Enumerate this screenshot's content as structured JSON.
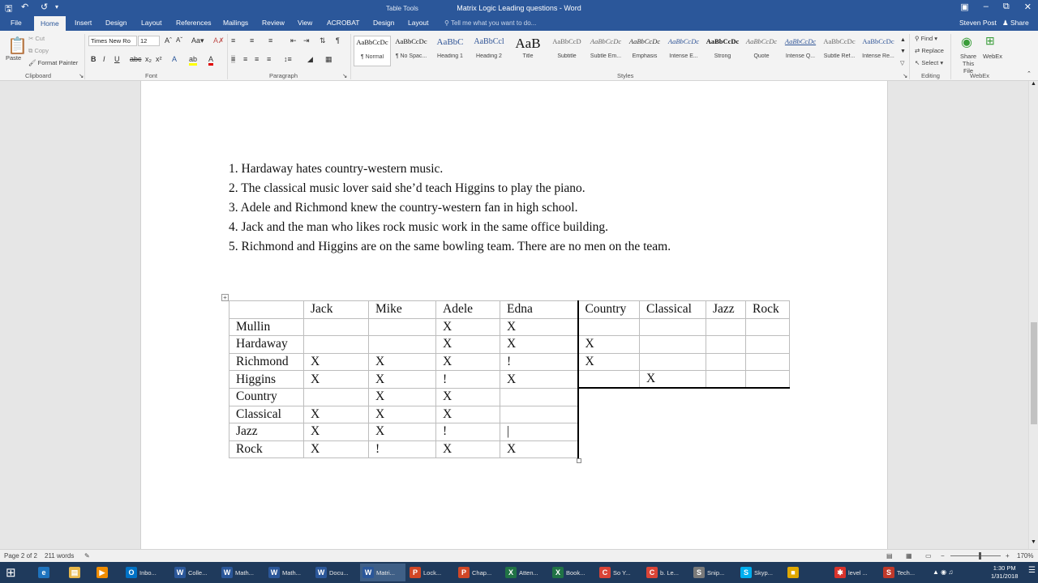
{
  "titlebar": {
    "context_label": "Table Tools",
    "doc_title": "Matrix Logic  Leading questions - Word",
    "user": "Steven Post",
    "share": "Share"
  },
  "tabs": [
    "File",
    "Home",
    "Insert",
    "Design",
    "Layout",
    "References",
    "Mailings",
    "Review",
    "View",
    "ACROBAT"
  ],
  "context_tabs": [
    "Design",
    "Layout"
  ],
  "tell_me_placeholder": "Tell me what you want to do...",
  "ribbon": {
    "clipboard": {
      "paste": "Paste",
      "cut": "Cut",
      "copy": "Copy",
      "format_painter": "Format Painter",
      "label": "Clipboard"
    },
    "font": {
      "name": "Times New Ro",
      "size": "12",
      "label": "Font"
    },
    "paragraph_label": "Paragraph",
    "styles_label": "Styles",
    "styles": [
      {
        "sample": "AaBbCcDc",
        "name": "¶ Normal"
      },
      {
        "sample": "AaBbCcDc",
        "name": "¶ No Spac..."
      },
      {
        "sample": "AaBbC",
        "name": "Heading 1"
      },
      {
        "sample": "AaBbCcl",
        "name": "Heading 2"
      },
      {
        "sample": "AaB",
        "name": "Title"
      },
      {
        "sample": "AaBbCcD",
        "name": "Subtitle"
      },
      {
        "sample": "AaBbCcDc",
        "name": "Subtle Em..."
      },
      {
        "sample": "AaBbCcDc",
        "name": "Emphasis"
      },
      {
        "sample": "AaBbCcDc",
        "name": "Intense E..."
      },
      {
        "sample": "AaBbCcDc",
        "name": "Strong"
      },
      {
        "sample": "AaBbCcDc",
        "name": "Quote"
      },
      {
        "sample": "AaBbCcDc",
        "name": "Intense Q..."
      },
      {
        "sample": "AaBbCcDc",
        "name": "Subtle Ref..."
      },
      {
        "sample": "AaBbCcDc",
        "name": "Intense Re..."
      }
    ],
    "editing": {
      "find": "Find",
      "replace": "Replace",
      "select": "Select",
      "label": "Editing"
    },
    "webex": {
      "share": "Share This File",
      "webex": "WebEx",
      "label": "WebEx"
    }
  },
  "clues": [
    "1. Hardaway hates country-western music.",
    "2. The classical music lover said she’d teach Higgins to play the piano.",
    "3. Adele and Richmond knew the country-western fan in high school.",
    "4. Jack and the man who likes rock music work in the same office building.",
    "5. Richmond and Higgins are on the same bowling team. There are no men on the team."
  ],
  "grid": {
    "header": [
      "",
      "Jack",
      "Mike",
      "Adele",
      "Edna",
      "Country",
      "Classical",
      "Jazz",
      "Rock"
    ],
    "rows": [
      [
        "Mullin",
        "",
        "",
        "X",
        "X",
        "",
        "",
        "",
        ""
      ],
      [
        "Hardaway",
        "",
        "",
        "X",
        "X",
        "X",
        "",
        "",
        ""
      ],
      [
        "Richmond",
        "X",
        "X",
        "X",
        "!",
        "X",
        "",
        "",
        ""
      ],
      [
        "Higgins",
        "X",
        "X",
        "!",
        "X",
        "",
        "X",
        "",
        ""
      ],
      [
        "Country",
        "",
        "X",
        "X",
        ""
      ],
      [
        "Classical",
        "X",
        "X",
        "X",
        ""
      ],
      [
        "Jazz",
        "X",
        "X",
        "!",
        "|"
      ],
      [
        "Rock",
        "X",
        "!",
        "X",
        "X"
      ]
    ]
  },
  "status": {
    "page": "Page 2 of 2",
    "words": "211 words",
    "zoom": "170%"
  },
  "taskbar": [
    {
      "label": "Inbo...",
      "icon": "O",
      "color": "#0072c6"
    },
    {
      "label": "Colle...",
      "icon": "W",
      "color": "#2b579a"
    },
    {
      "label": "Math...",
      "icon": "W",
      "color": "#2b579a"
    },
    {
      "label": "Math...",
      "icon": "W",
      "color": "#2b579a"
    },
    {
      "label": "Docu...",
      "icon": "W",
      "color": "#2b579a"
    },
    {
      "label": "Matri...",
      "icon": "W",
      "color": "#2b579a"
    },
    {
      "label": "Lock...",
      "icon": "P",
      "color": "#d24726"
    },
    {
      "label": "Chap...",
      "icon": "P",
      "color": "#d24726"
    },
    {
      "label": "Atten...",
      "icon": "X",
      "color": "#217346"
    },
    {
      "label": "Book...",
      "icon": "X",
      "color": "#217346"
    },
    {
      "label": "So Y...",
      "icon": "C",
      "color": "#db4437"
    },
    {
      "label": "b. Le...",
      "icon": "C",
      "color": "#db4437"
    },
    {
      "label": "Snip...",
      "icon": "S",
      "color": "#7a7a7a"
    },
    {
      "label": "Skyp...",
      "icon": "S",
      "color": "#00aff0"
    },
    {
      "label": "",
      "icon": "■",
      "color": "#e0a800"
    },
    {
      "label": "level ...",
      "icon": "✱",
      "color": "#d9332c"
    },
    {
      "label": "Tech...",
      "icon": "S",
      "color": "#c0392b"
    }
  ],
  "clock": {
    "time": "1:30 PM",
    "date": "1/31/2018"
  }
}
